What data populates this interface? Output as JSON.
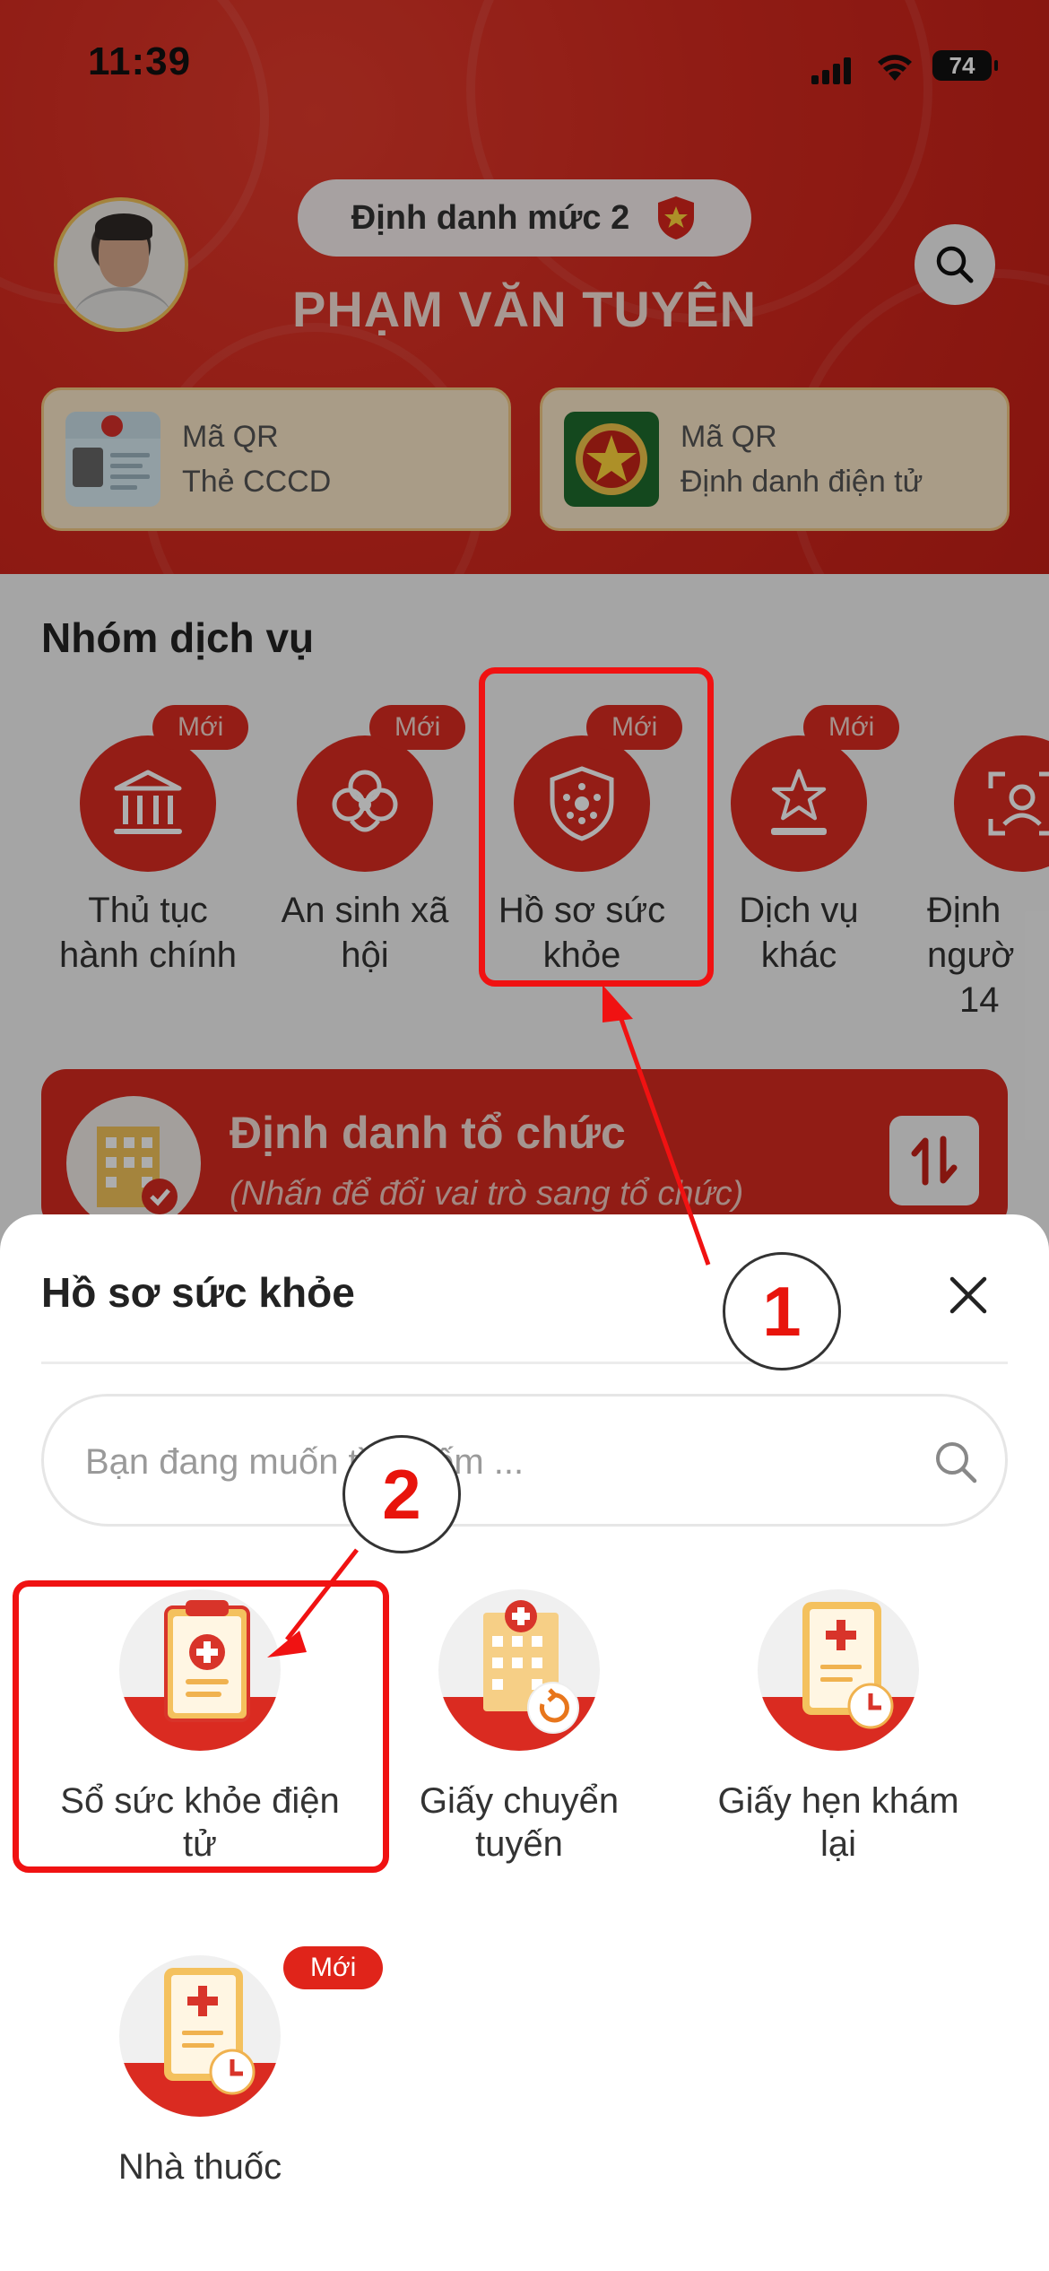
{
  "status_bar": {
    "time": "11:39",
    "battery": "74"
  },
  "header": {
    "level_badge": "Định danh mức 2",
    "user_name": "PHẠM VĂN TUYÊN",
    "qr_cards": [
      {
        "line1": "Mã QR",
        "line2": "Thẻ CCCD"
      },
      {
        "line1": "Mã QR",
        "line2": "Định danh điện tử"
      }
    ]
  },
  "services": {
    "title": "Nhóm dịch vụ",
    "items": [
      {
        "badge": "Mới",
        "line1": "Thủ tục",
        "line2": "hành chính",
        "line3": ""
      },
      {
        "badge": "Mới",
        "line1": "An sinh xã",
        "line2": "hội",
        "line3": ""
      },
      {
        "badge": "Mới",
        "line1": "Hồ sơ sức",
        "line2": "khỏe",
        "line3": ""
      },
      {
        "badge": "Mới",
        "line1": "Dịch vụ",
        "line2": "khác",
        "line3": ""
      },
      {
        "badge": "",
        "line1": "Định",
        "line2": "ngườ",
        "line3": "14"
      }
    ]
  },
  "org_card": {
    "title": "Định danh tổ chức",
    "subtitle": "(Nhấn để đổi vai trò sang tổ chức)"
  },
  "sheet": {
    "title": "Hồ sơ sức khỏe",
    "search_placeholder": "Bạn đang muốn tìm kiếm ...",
    "items": [
      {
        "line1": "Sổ sức khỏe điện",
        "line2": "tử",
        "badge": ""
      },
      {
        "line1": "Giấy chuyển",
        "line2": "tuyến",
        "badge": ""
      },
      {
        "line1": "Giấy hẹn khám",
        "line2": "lại",
        "badge": ""
      },
      {
        "line1": "Nhà thuốc",
        "line2": "",
        "badge": "Mới"
      }
    ]
  },
  "annotations": {
    "step1": "1",
    "step2": "2"
  },
  "colors": {
    "brand_red": "#da2b21",
    "annotation_red": "#f01212",
    "gold": "#f2c35a"
  }
}
